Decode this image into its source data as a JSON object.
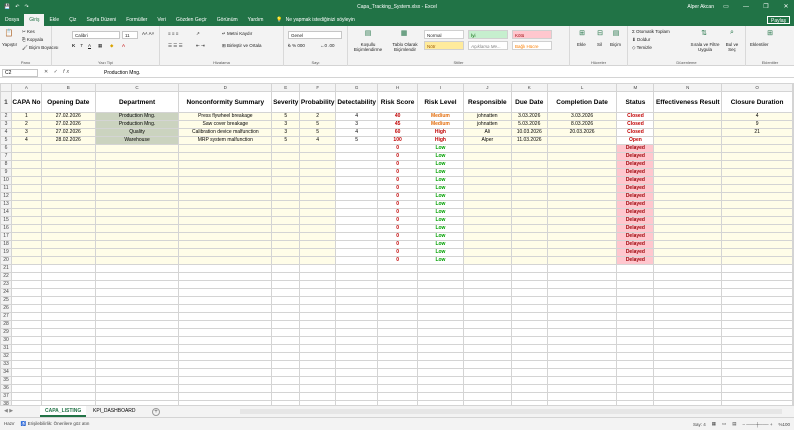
{
  "titlebar": {
    "window_title": "Capa_Tracking_System.xlsx  -  Excel",
    "user": "Alper Akcan"
  },
  "menu": {
    "tabs": [
      "Dosya",
      "Giriş",
      "Ekle",
      "Çiz",
      "Sayfa Düzeni",
      "Formüller",
      "Veri",
      "Gözden Geçir",
      "Görünüm",
      "Yardım"
    ],
    "active": "Giriş",
    "tell_me": "Ne yapmak istediğinizi söyleyin",
    "share": "Paylaş"
  },
  "ribbon": {
    "paste": "Yapıştır",
    "cut": "Kes",
    "copy": "Kopyala",
    "format_painter": "Biçim Boyacısı",
    "clipboard": "Pano",
    "font_name": "Calibri",
    "font_size": "11",
    "font_group": "Yazı Tipi",
    "wrap_text": "Metni Kaydır",
    "merge_center": "Birleştir ve Ortala",
    "alignment_group": "Hizalama",
    "number_format": "Genel",
    "number_group": "Sayı",
    "conditional_format": "Koşullu Biçimlendirme",
    "format_as_table": "Tablo Olarak Biçimlendir",
    "styles": [
      "Normal",
      "İyi",
      "Kötü",
      "Nötr",
      "Açıklama Me...",
      "Bağlı Hücre"
    ],
    "styles_group": "Stiller",
    "insert": "Ekle",
    "delete": "Sil",
    "format": "Biçim",
    "cells_group": "Hücreler",
    "autosum": "Otomatik Toplam",
    "fill": "Doldur",
    "clear": "Temizle",
    "sort_filter": "Sırala ve Filtre Uygula",
    "find_select": "Bul ve Seç",
    "editing_group": "Düzenleme",
    "addins": "Eklentiler",
    "addins_group": "Eklentiler"
  },
  "formula_bar": {
    "cell": "C2",
    "fx": "fx",
    "content": "Production Mng."
  },
  "sheet": {
    "columns": [
      "A",
      "B",
      "C",
      "D",
      "E",
      "F",
      "G",
      "H",
      "I",
      "J",
      "K",
      "L",
      "M",
      "N",
      "O"
    ],
    "headers": [
      "CAPA No",
      "Opening Date",
      "Department",
      "Nonconformity Summary",
      "Severity",
      "Probability",
      "Detectability",
      "Risk Score",
      "Risk Level",
      "Responsible",
      "Due Date",
      "Completion Date",
      "Status",
      "Effectiveness Result",
      "Closure Duration"
    ],
    "rows": [
      [
        "1",
        "27.02.2026",
        "Production Mng.",
        "Press flywheel breakage",
        "5",
        "2",
        "4",
        "40",
        "Medium",
        "johnatten",
        "3.03.2026",
        "3.03.2026",
        "Closed",
        "",
        "4"
      ],
      [
        "2",
        "27.02.2026",
        "Production Mng.",
        "Saw cover breakage",
        "3",
        "5",
        "3",
        "45",
        "Medium",
        "johnatten",
        "5.03.2026",
        "8.03.2026",
        "Closed",
        "",
        "9"
      ],
      [
        "3",
        "27.02.2026",
        "Quality",
        "Calibration device malfunction",
        "3",
        "5",
        "4",
        "60",
        "High",
        "Ali",
        "10.03.2026",
        "20.03.2026",
        "Closed",
        "",
        "21"
      ],
      [
        "4",
        "28.02.2026",
        "Warehouse",
        "MRP system malfunction",
        "5",
        "4",
        "5",
        "100",
        "High",
        "Alper",
        "11.03.2026",
        "",
        "Open",
        "",
        ""
      ]
    ],
    "empty_risk_score": "0",
    "empty_risk_level": "Low",
    "empty_status": "Delayed",
    "empty_row_count": 15,
    "total_rows": 40
  },
  "tabs": {
    "sheets": [
      "CAPA_LISTING",
      "KPI_DASHBOARD"
    ],
    "active": "CAPA_LISTING"
  },
  "status": {
    "ready": "Hazır",
    "accessibility": "Erişilebilirlik: Önerilere göz atın",
    "count": "Say: 4",
    "zoom": "%100"
  }
}
